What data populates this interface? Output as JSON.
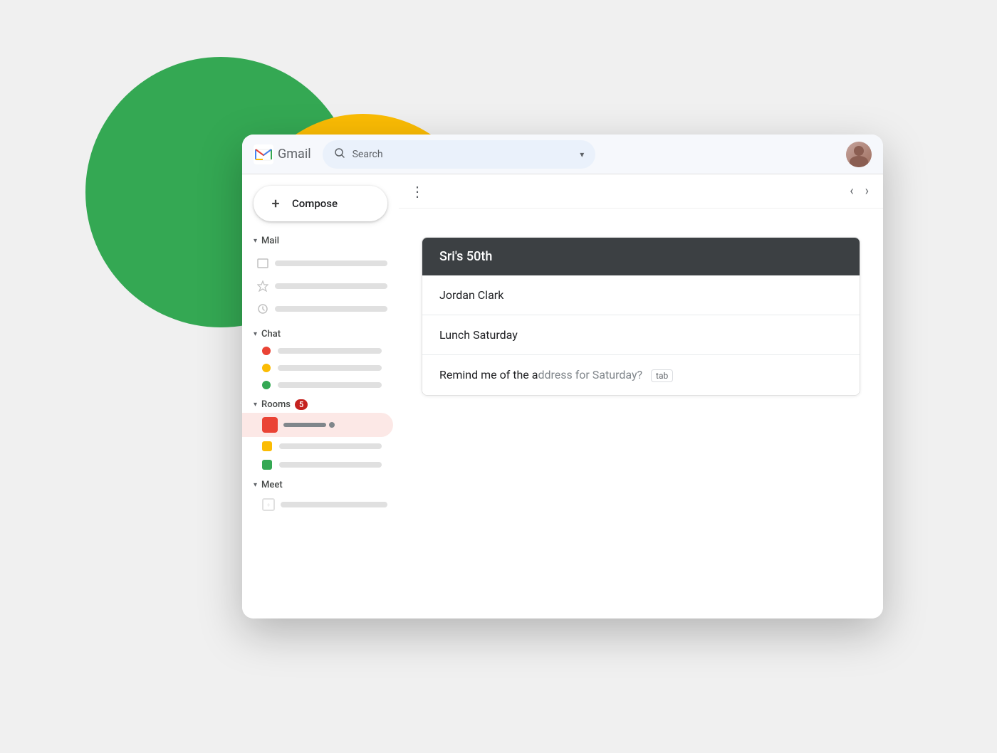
{
  "background": {
    "green_circle": "decorative",
    "yellow_circle": "decorative"
  },
  "header": {
    "gmail_label": "Gmail",
    "search_placeholder": "Search",
    "avatar_alt": "User avatar"
  },
  "sidebar": {
    "compose_label": "Compose",
    "sections": {
      "mail": {
        "label": "Mail",
        "chevron": "▾"
      },
      "chat": {
        "label": "Chat",
        "chevron": "▾",
        "items": [
          {
            "color": "red"
          },
          {
            "color": "yellow"
          },
          {
            "color": "green"
          }
        ]
      },
      "rooms": {
        "label": "Rooms",
        "chevron": "▾",
        "badge": "5",
        "items": [
          {
            "color": "red",
            "active": true
          },
          {
            "color": "yellow"
          },
          {
            "color": "green"
          }
        ]
      },
      "meet": {
        "label": "Meet",
        "chevron": "▾"
      }
    }
  },
  "toolbar": {
    "more_options": "⋮",
    "back_arrow": "‹",
    "forward_arrow": "›"
  },
  "email_thread": {
    "title": "Sri's 50th",
    "items": [
      {
        "text": "Jordan Clark"
      },
      {
        "text": "Lunch Saturday"
      },
      {
        "text_typed": "Remind me of the a",
        "text_suggest": "ddress for Saturday?",
        "tab_label": "tab"
      }
    ]
  }
}
